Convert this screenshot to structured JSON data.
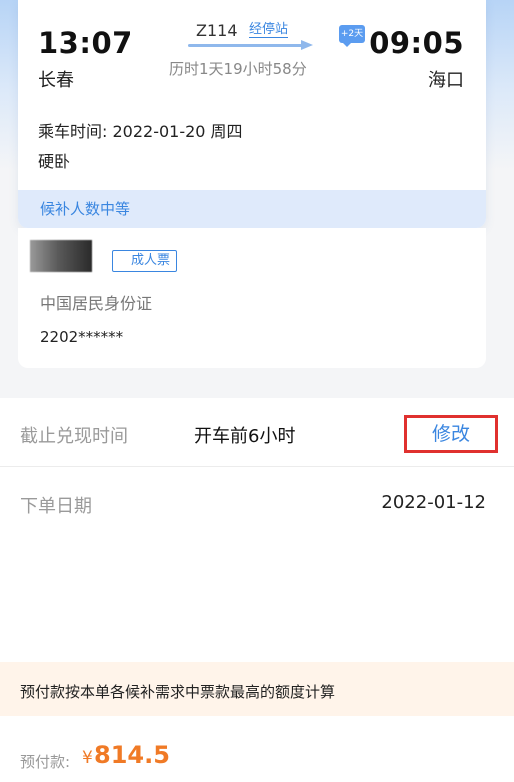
{
  "trip": {
    "departure_time": "13:07",
    "departure_station": "长春",
    "train_number": "Z114",
    "stops_link": "经停站",
    "duration": "历时1天19小时58分",
    "plus_day_badge": "+2天",
    "arrival_time": "09:05",
    "arrival_station": "海口",
    "ride_date": "乘车时间: 2022-01-20 周四",
    "seat_type": "硬卧",
    "status": "候补人数中等"
  },
  "passenger": {
    "ticket_type": "成人票",
    "id_type": "中国居民身份证",
    "id_number": "2202******"
  },
  "order": {
    "deadline_label": "截止兑现时间",
    "deadline_value": "开车前6小时",
    "edit_label": "修改",
    "order_date_label": "下单日期",
    "order_date_value": "2022-01-12"
  },
  "payment": {
    "notice": "预付款按本单各候补需求中票款最高的额度计算",
    "label": "预付款:",
    "currency": "¥",
    "amount": "814.5"
  },
  "colors": {
    "accent_blue": "#3a86e0",
    "highlight_red": "#e0312f",
    "price_orange": "#f07a26"
  }
}
